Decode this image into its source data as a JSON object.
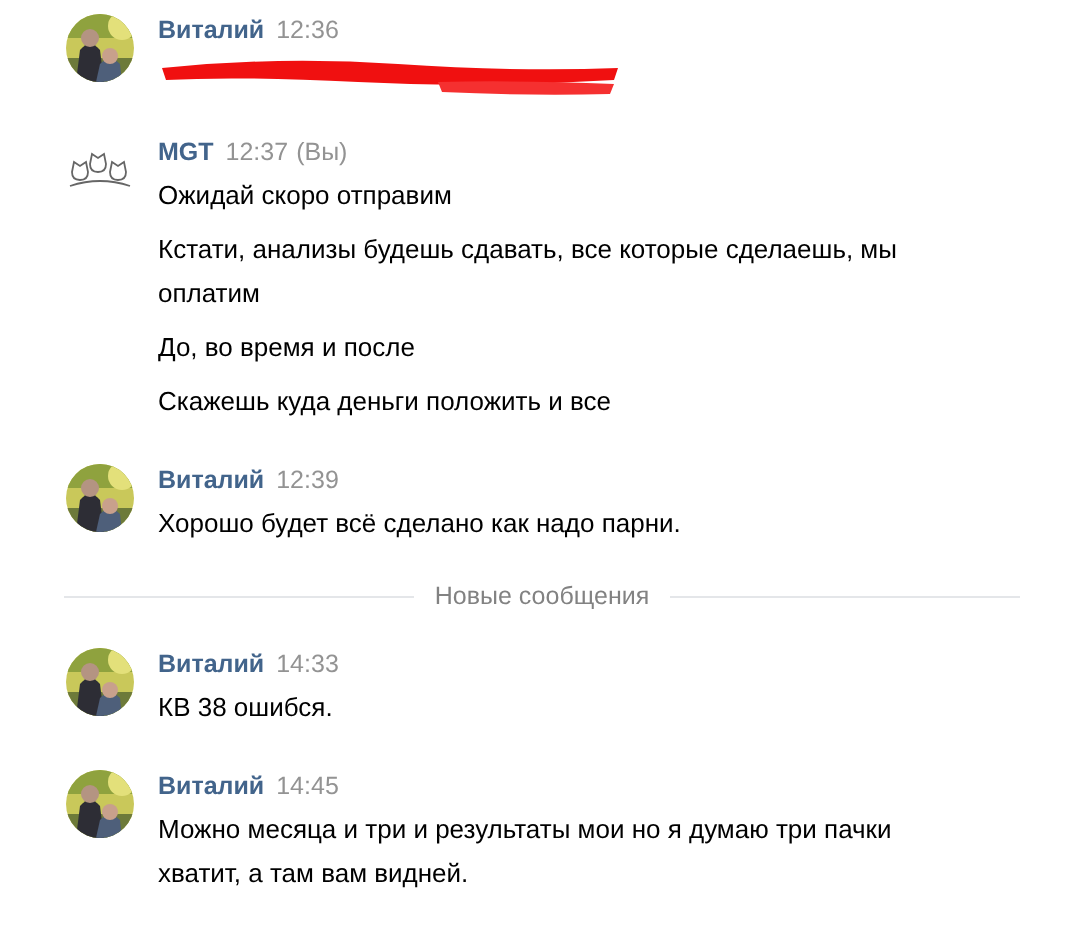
{
  "items": [
    {
      "kind": "message",
      "author": "Виталий",
      "time": "12:36",
      "paragraphs": [
        {
          "kind": "redacted"
        }
      ]
    },
    {
      "kind": "message",
      "author": "MGT",
      "avatar": {
        "kind": "logo"
      },
      "time": "12:37",
      "self_label": "(Вы)",
      "paragraphs": [
        {
          "kind": "text",
          "text": "Ожидай скоро отправим"
        },
        {
          "kind": "text",
          "text": "Кстати, анализы будешь сдавать, все которые сделаешь, мы оплатим"
        },
        {
          "kind": "text",
          "text": "До, во время и после"
        },
        {
          "kind": "text",
          "text": "Скажешь куда деньги положить и все"
        }
      ]
    },
    {
      "kind": "message",
      "author": "Виталий",
      "time": "12:39",
      "paragraphs": [
        {
          "kind": "text",
          "text": "Хорошо будет всё сделано как надо парни."
        }
      ]
    },
    {
      "kind": "divider",
      "label": "Новые сообщения"
    },
    {
      "kind": "message",
      "author": "Виталий",
      "time": "14:33",
      "paragraphs": [
        {
          "kind": "text",
          "text": "КВ 38 ошибся."
        }
      ]
    },
    {
      "kind": "message",
      "author": "Виталий",
      "time": "14:45",
      "paragraphs": [
        {
          "kind": "text",
          "text": "Можно месяца и три и результаты мои но я думаю три пачки хватит, а там вам видней."
        }
      ]
    }
  ]
}
